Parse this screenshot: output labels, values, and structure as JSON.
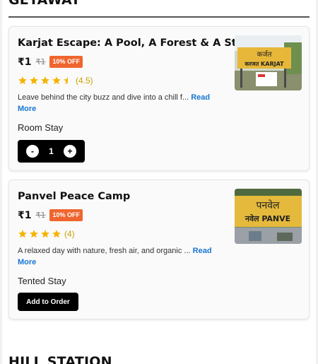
{
  "sections": {
    "top_title": "GETAWAY",
    "bottom_title": "HILL STATION"
  },
  "cards": [
    {
      "title": "Karjat Escape: A Pool, A Forest & A Story",
      "price": "₹1",
      "old_price": "₹1",
      "discount": "10% OFF",
      "rating": 4.5,
      "rating_text": "(4.5)",
      "description": "Leave behind the city buzz and dive into a chill f...",
      "read_more": "Read More",
      "stay_type": "Room Stay",
      "quantity": "1",
      "minus_label": "-",
      "plus_label": "+",
      "sign_line1": "कर्जत",
      "sign_line2": "करजत KARJAT"
    },
    {
      "title": "Panvel Peace Camp",
      "price": "₹1",
      "old_price": "₹1",
      "discount": "10% OFF",
      "rating": 4,
      "rating_text": "(4)",
      "description": "A relaxed day with nature, fresh air, and organic ...",
      "read_more": "Read More",
      "stay_type": "Tented Stay",
      "add_button": "Add to Order",
      "sign_line1": "पनवेल",
      "sign_line2": "नवेल PANVE"
    }
  ],
  "colors": {
    "badge": "#f0652f",
    "star": "#f5b301",
    "link": "#1976d2",
    "button": "#000000"
  }
}
